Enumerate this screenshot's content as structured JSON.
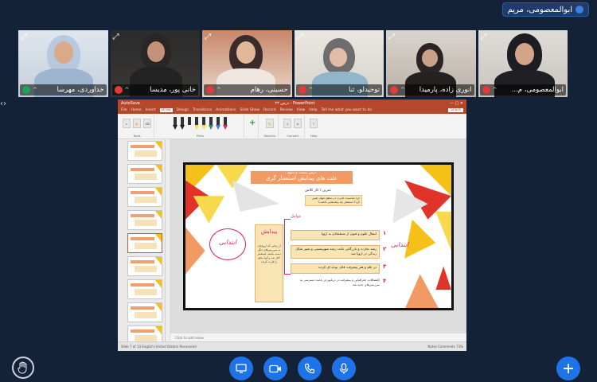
{
  "presenter": {
    "name": "ابوالمعصومی، مریم"
  },
  "participants": [
    {
      "name": "خداوردی، مهرسا",
      "mic": "on"
    },
    {
      "name": "خانی پور، مدیسا",
      "mic": "off"
    },
    {
      "name": "حسینی، رهام",
      "mic": "off"
    },
    {
      "name": "توحیدلو، ثنا",
      "mic": "off"
    },
    {
      "name": "انوری زاده، پارمیدا",
      "mic": "off"
    },
    {
      "name": "ابوالمعصومی، م...",
      "mic": "off",
      "active": true
    }
  ],
  "ppt": {
    "title_left": "AutoSave",
    "title_center": "درس ۲۳ - PowerPoint",
    "menu": [
      "File",
      "Home",
      "Insert",
      "Draw",
      "Design",
      "Transitions",
      "Animations",
      "Slide Show",
      "Record",
      "Review",
      "View",
      "Help",
      "Tell me what you want to do"
    ],
    "menu_selected": "Draw",
    "share_label": "Share",
    "ribbon_groups": [
      {
        "caption": "Tools",
        "items": [
          "Select",
          "Draw with Touch",
          "Eraser"
        ]
      },
      {
        "caption": "Pens",
        "items": []
      },
      {
        "caption": "Stencils",
        "items": [
          "Ruler"
        ]
      },
      {
        "caption": "Convert",
        "items": [
          "Ink to Shape",
          "Ink to Math"
        ]
      },
      {
        "caption": "Help",
        "items": [
          "Ink Help"
        ]
      }
    ],
    "pen_colors": [
      "#222222",
      "#222222",
      "#f2f2f2",
      "#f5e12a",
      "#f5e12a",
      "#2e8b57",
      "#3d7fe0",
      "#d8246a"
    ],
    "thumb_numbers": [
      "",
      "",
      "",
      "",
      "",
      "",
      "",
      "",
      ""
    ],
    "notes_placeholder": "Click to add notes",
    "status_left": "Slide 7 of 14   English (United States)   Recovered",
    "status_right": "Notes   Comments   73%"
  },
  "slide": {
    "header_small": "درس بیست و سوم",
    "header_title": "علت های پیدایش استعمار گری",
    "subtitle": "تمرین / کار کلاس",
    "question": "چرا مناسبات قدرت در سطح جهان تغییر کرد؟ استعمار چه پیامدهایی داشت؟",
    "side_note": "عوامل",
    "circle_text": "ابتدایی",
    "box_title": "پیدایش",
    "box_text": "از زمانی که اروپاییان به سرزمین‌های دیگر دست یافتند، استعمار آغاز شد و آنها منابع را غارت کردند",
    "items": [
      {
        "num": "۱",
        "text": "انتقال علوم و فنون از مسلمانان به اروپا"
      },
      {
        "num": "۲",
        "text": "رشد تجارت و بازرگانی باعث رشد شهرنشینی و تغییر شکل زندگی در اروپا شد"
      },
      {
        "num": "۳",
        "text": "در علم و هنر پیشرفت قابل توجه ای کردند"
      },
      {
        "num": "۴",
        "text": "اکتشافات جغرافیایی و پیشرفت در دریانوردی باعث دسترسی به سرزمین‌های جدید شد"
      }
    ],
    "right_text": "ابتدایی"
  },
  "colors": {
    "bg": "#142238",
    "accent": "#1e73e8",
    "ppt_red": "#b7472a",
    "slide_orange": "#f29a63",
    "slide_yellow": "#f5c118",
    "slide_red": "#e0342a",
    "ink_pink": "#d8246a"
  },
  "icons": {
    "hand": "raise-hand-icon",
    "screen": "screen-share-icon",
    "camera": "camera-icon",
    "phone": "phone-icon",
    "mic": "microphone-icon",
    "plus": "plus-icon"
  }
}
